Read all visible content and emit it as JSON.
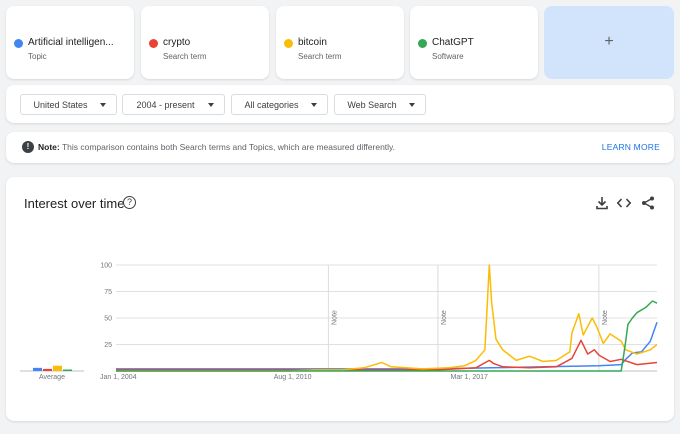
{
  "terms": [
    {
      "name": "Artificial intelligen...",
      "type": "Topic",
      "color": "#4285f4"
    },
    {
      "name": "crypto",
      "type": "Search term",
      "color": "#ea4335"
    },
    {
      "name": "bitcoin",
      "type": "Search term",
      "color": "#fbbc04"
    },
    {
      "name": "ChatGPT",
      "type": "Software",
      "color": "#34a853"
    }
  ],
  "add_term": {
    "label": "+"
  },
  "filters": {
    "region": "United States",
    "period": "2004 - present",
    "category": "All categories",
    "source": "Web Search"
  },
  "note": {
    "icon": "!",
    "prefix": "Note:",
    "text": "This comparison contains both Search terms and Topics, which are measured differently.",
    "learn_more": "LEARN MORE"
  },
  "panel": {
    "title": "Interest over time",
    "help_icon": "?"
  },
  "chart_data": {
    "type": "line",
    "x_range": [
      "2004-01",
      "2024-03"
    ],
    "x_ticks": [
      "Jan 1, 2004",
      "Aug 1, 2010",
      "Mar 1, 2017"
    ],
    "y_ticks": [
      25,
      50,
      75,
      100
    ],
    "ylim": [
      0,
      100
    ],
    "grid": true,
    "annotations": [
      {
        "label": "Note",
        "date": "2011-12"
      },
      {
        "label": "Note",
        "date": "2016-01"
      },
      {
        "label": "Note",
        "date": "2022-01"
      }
    ],
    "average_label": "Average",
    "averages": [
      3,
      2,
      5,
      1
    ],
    "series": [
      {
        "name": "Artificial intelligen...",
        "color": "#4285f4",
        "points": [
          [
            "2004-01",
            2
          ],
          [
            "2008-01",
            2
          ],
          [
            "2012-01",
            2
          ],
          [
            "2016-01",
            2
          ],
          [
            "2018-01",
            3
          ],
          [
            "2020-01",
            4
          ],
          [
            "2022-01",
            5
          ],
          [
            "2022-11",
            6
          ],
          [
            "2023-01",
            11
          ],
          [
            "2023-04",
            17
          ],
          [
            "2023-08",
            18
          ],
          [
            "2023-12",
            28
          ],
          [
            "2024-03",
            46
          ]
        ]
      },
      {
        "name": "crypto",
        "color": "#ea4335",
        "points": [
          [
            "2004-01",
            1
          ],
          [
            "2013-01",
            1
          ],
          [
            "2016-01",
            1
          ],
          [
            "2017-06",
            3
          ],
          [
            "2017-12",
            10
          ],
          [
            "2018-02",
            7
          ],
          [
            "2018-06",
            4
          ],
          [
            "2019-06",
            3
          ],
          [
            "2020-06",
            4
          ],
          [
            "2021-01",
            12
          ],
          [
            "2021-05",
            29
          ],
          [
            "2021-08",
            16
          ],
          [
            "2021-11",
            20
          ],
          [
            "2022-01",
            15
          ],
          [
            "2022-06",
            9
          ],
          [
            "2022-11",
            11
          ],
          [
            "2023-06",
            6
          ],
          [
            "2024-03",
            8
          ]
        ]
      },
      {
        "name": "bitcoin",
        "color": "#fbbc04",
        "points": [
          [
            "2004-01",
            0
          ],
          [
            "2010-06",
            0
          ],
          [
            "2011-06",
            1
          ],
          [
            "2012-06",
            1
          ],
          [
            "2013-04",
            3
          ],
          [
            "2013-12",
            8
          ],
          [
            "2014-04",
            4
          ],
          [
            "2015-06",
            2
          ],
          [
            "2016-06",
            3
          ],
          [
            "2017-01",
            5
          ],
          [
            "2017-06",
            10
          ],
          [
            "2017-10",
            20
          ],
          [
            "2017-12",
            100
          ],
          [
            "2018-01",
            65
          ],
          [
            "2018-03",
            30
          ],
          [
            "2018-06",
            20
          ],
          [
            "2018-12",
            10
          ],
          [
            "2019-06",
            14
          ],
          [
            "2019-12",
            9
          ],
          [
            "2020-06",
            10
          ],
          [
            "2020-12",
            18
          ],
          [
            "2021-01",
            36
          ],
          [
            "2021-04",
            54
          ],
          [
            "2021-06",
            34
          ],
          [
            "2021-10",
            50
          ],
          [
            "2021-12",
            42
          ],
          [
            "2022-03",
            26
          ],
          [
            "2022-06",
            35
          ],
          [
            "2022-11",
            28
          ],
          [
            "2023-01",
            20
          ],
          [
            "2023-06",
            16
          ],
          [
            "2023-12",
            20
          ],
          [
            "2024-03",
            25
          ]
        ]
      },
      {
        "name": "ChatGPT",
        "color": "#34a853",
        "points": [
          [
            "2004-01",
            0
          ],
          [
            "2022-11",
            0
          ],
          [
            "2022-12",
            14
          ],
          [
            "2023-01",
            28
          ],
          [
            "2023-02",
            44
          ],
          [
            "2023-04",
            50
          ],
          [
            "2023-06",
            55
          ],
          [
            "2023-10",
            60
          ],
          [
            "2024-01",
            66
          ],
          [
            "2024-03",
            64
          ]
        ]
      }
    ]
  }
}
